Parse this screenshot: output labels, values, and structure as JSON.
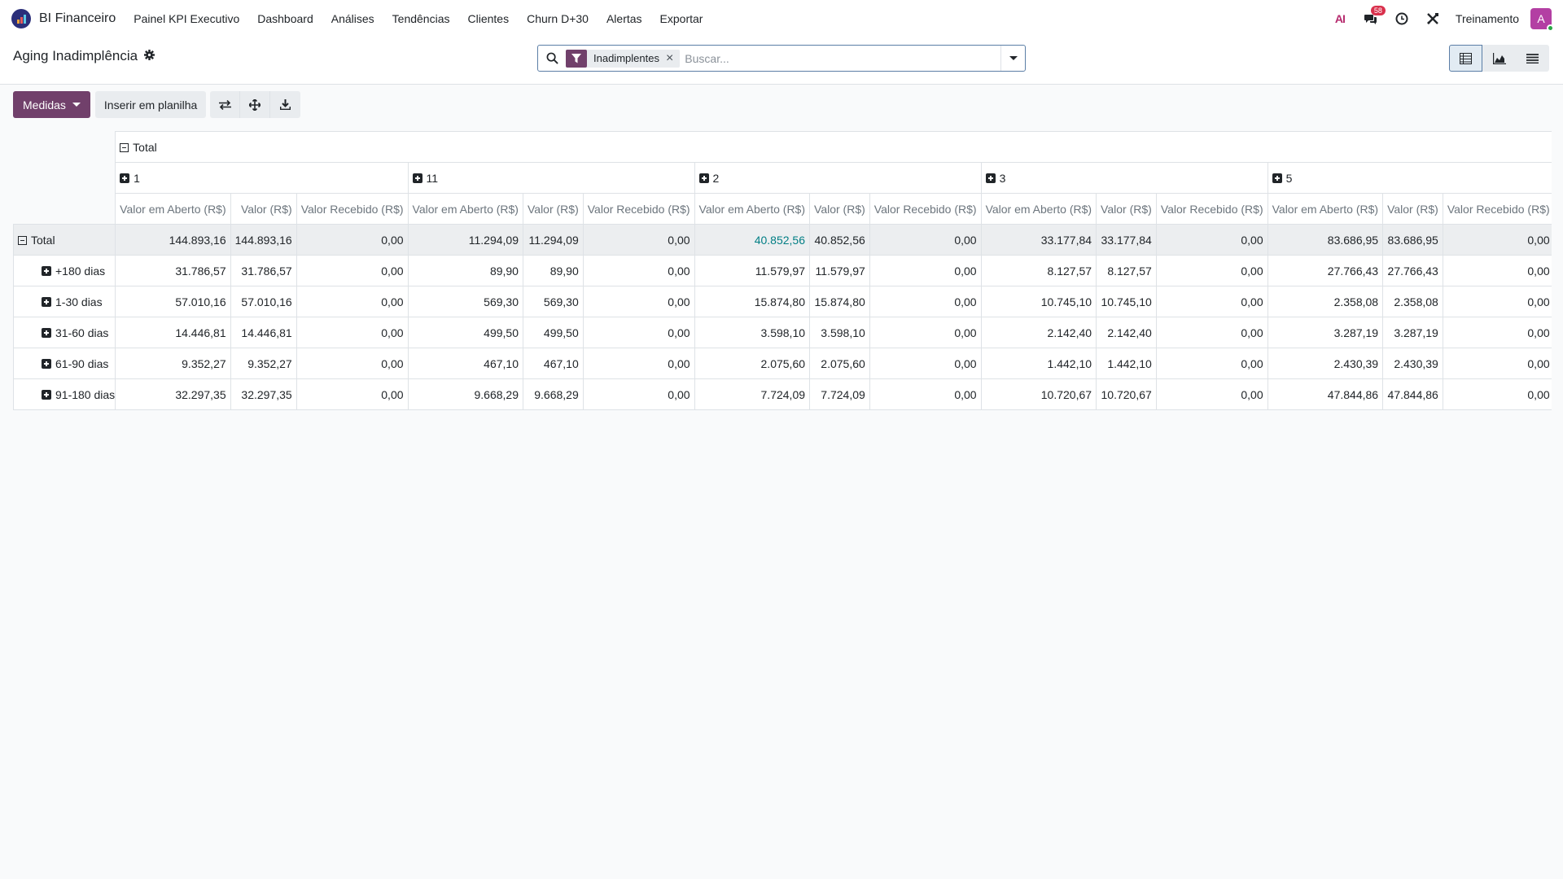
{
  "navbar": {
    "app_name": "BI Financeiro",
    "menu": [
      "Painel KPI Executivo",
      "Dashboard",
      "Análises",
      "Tendências",
      "Clientes",
      "Churn D+30",
      "Alertas",
      "Exportar"
    ],
    "ai_label": "AI",
    "messages_count": "58",
    "company": "Treinamento",
    "avatar_letter": "A"
  },
  "control_panel": {
    "title": "Aging Inadimplência",
    "facet_label": "Inadimplentes",
    "search_placeholder": "Buscar..."
  },
  "toolbar": {
    "measures_label": "Medidas",
    "insert_label": "Inserir em planilha"
  },
  "pivot": {
    "top_header": "Total",
    "col_groups": [
      "1",
      "11",
      "2",
      "3",
      "5"
    ],
    "measures": [
      "Valor em Aberto (R$)",
      "Valor (R$)",
      "Valor Recebido (R$)"
    ],
    "rows": [
      {
        "label": "Total",
        "values": [
          "144.893,16",
          "144.893,16",
          "0,00",
          "11.294,09",
          "11.294,09",
          "0,00",
          "40.852,56",
          "40.852,56",
          "0,00",
          "33.177,84",
          "33.177,84",
          "0,00",
          "83.686,95",
          "83.686,95",
          "0,00"
        ]
      },
      {
        "label": "+180 dias",
        "values": [
          "31.786,57",
          "31.786,57",
          "0,00",
          "89,90",
          "89,90",
          "0,00",
          "11.579,97",
          "11.579,97",
          "0,00",
          "8.127,57",
          "8.127,57",
          "0,00",
          "27.766,43",
          "27.766,43",
          "0,00"
        ]
      },
      {
        "label": "1-30 dias",
        "values": [
          "57.010,16",
          "57.010,16",
          "0,00",
          "569,30",
          "569,30",
          "0,00",
          "15.874,80",
          "15.874,80",
          "0,00",
          "10.745,10",
          "10.745,10",
          "0,00",
          "2.358,08",
          "2.358,08",
          "0,00"
        ]
      },
      {
        "label": "31-60 dias",
        "values": [
          "14.446,81",
          "14.446,81",
          "0,00",
          "499,50",
          "499,50",
          "0,00",
          "3.598,10",
          "3.598,10",
          "0,00",
          "2.142,40",
          "2.142,40",
          "0,00",
          "3.287,19",
          "3.287,19",
          "0,00"
        ]
      },
      {
        "label": "61-90 dias",
        "values": [
          "9.352,27",
          "9.352,27",
          "0,00",
          "467,10",
          "467,10",
          "0,00",
          "2.075,60",
          "2.075,60",
          "0,00",
          "1.442,10",
          "1.442,10",
          "0,00",
          "2.430,39",
          "2.430,39",
          "0,00"
        ]
      },
      {
        "label": "91-180 dias",
        "values": [
          "32.297,35",
          "32.297,35",
          "0,00",
          "9.668,29",
          "9.668,29",
          "0,00",
          "7.724,09",
          "7.724,09",
          "0,00",
          "10.720,67",
          "10.720,67",
          "0,00",
          "47.844,86",
          "47.844,86",
          "0,00"
        ]
      }
    ]
  }
}
